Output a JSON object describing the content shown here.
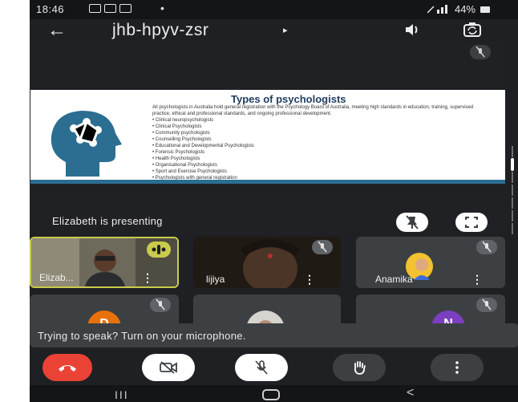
{
  "status_bar": {
    "time": "18:46",
    "dot": "•",
    "battery": "44%"
  },
  "header": {
    "meeting_code": "jhb-hpyv-zsr",
    "chevron": "▸",
    "back": "←"
  },
  "presentation": {
    "slide_title": "Types of psychologists",
    "slide_intro": "All psychologists in Australia hold general registration with the Psychology Board of Australia, meeting high standards in education, training, supervised practice, ethical and professional standards, and ongoing professional development.",
    "slide_items": [
      "Clinical neuropsychologists",
      "Clinical Psychologists",
      "Community psychologists",
      "Counselling Psychologists",
      "Educational and Developmental Psychologists",
      "Forensic Psychologists",
      "Health Psychologists",
      "Organisational Psychologists",
      "Sport and Exercise Psychologists",
      "Psychologists with general registration"
    ],
    "label": "Elizabeth is presenting"
  },
  "participants": [
    {
      "name": "Elizab...",
      "status": "speaking"
    },
    {
      "name": "lijiya",
      "status": "muted"
    },
    {
      "name": "Anamika",
      "status": "muted"
    },
    {
      "initial": "D",
      "status": "muted",
      "color": "#e8710a"
    },
    {
      "status": "muted"
    },
    {
      "initial": "N",
      "status": "muted",
      "color": "#7b3fc0"
    }
  ],
  "banner": {
    "text": "Trying to speak? Turn on your microphone."
  },
  "nav": {
    "recents": "III",
    "back": "<"
  },
  "colors": {
    "end_call": "#ea4335",
    "speaking": "#c9cc4a",
    "slide_bar": "#2b6e92"
  },
  "more_glyph": "⋮"
}
